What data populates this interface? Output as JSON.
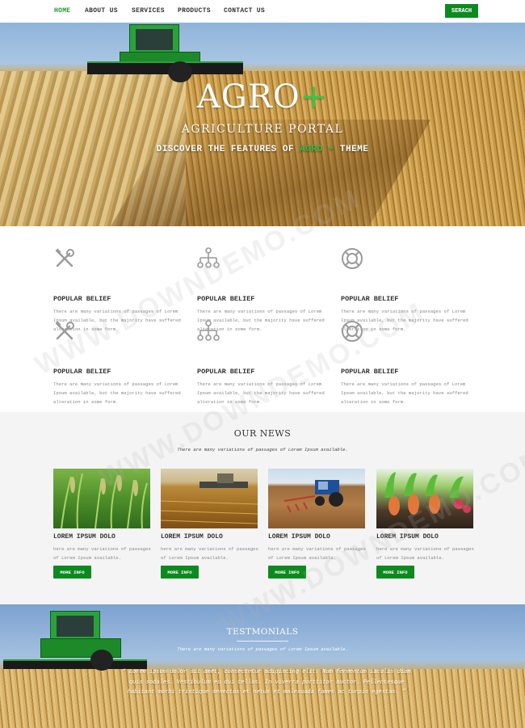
{
  "nav": {
    "items": [
      {
        "label": "HOME",
        "active": true
      },
      {
        "label": "ABOUT US",
        "active": false
      },
      {
        "label": "SERVICES",
        "active": false
      },
      {
        "label": "PRODUCTS",
        "active": false
      },
      {
        "label": "CONTACT US",
        "active": false
      }
    ],
    "search_label": "SERACH"
  },
  "hero": {
    "title_main": "AGRO",
    "title_plus": "+",
    "subtitle": "AGRICULTURE PORTAL",
    "tagline_before": "DISCOVER THE FEATURES OF",
    "tagline_highlight": "AGRO +",
    "tagline_after": "THEME"
  },
  "features": [
    {
      "icon": "tools-icon",
      "title": "POPULAR BELIEF",
      "text": "There are many variations of passages of Lorem Ipsum available, but the majority have suffered alteration in some form."
    },
    {
      "icon": "network-icon",
      "title": "POPULAR BELIEF",
      "text": "There are many variations of passages of Lorem Ipsum available, but the majority have suffered alteration in some form."
    },
    {
      "icon": "lifebuoy-icon",
      "title": "POPULAR BELIEF",
      "text": "There are many variations of passages of Lorem Ipsum available, but the majority have suffered alteration in some form."
    },
    {
      "icon": "tools-icon",
      "title": "POPULAR BELIEF",
      "text": "There are many variations of passages of Lorem Ipsum available, but the majority have suffered alteration in some form."
    },
    {
      "icon": "network-icon",
      "title": "POPULAR BELIEF",
      "text": "There are many variations of passages of Lorem Ipsum available, but the majority have suffered alteration in some form."
    },
    {
      "icon": "lifebuoy-icon",
      "title": "POPULAR BELIEF",
      "text": "There are many variations of passages of Lorem Ipsum available, but the majority have suffered alteration in some form."
    }
  ],
  "news": {
    "title": "OUR NEWS",
    "subtitle": "There are many variations of passages of Lorem Ipsum available.",
    "cards": [
      {
        "title": "LOREM IPSUM DOLO",
        "text": "here are many variations of passages of Lorem Ipsum available.",
        "button": "MORE INFO"
      },
      {
        "title": "LOREM IPSUM DOLO",
        "text": "here are many variations of passages of Lorem Ipsum available.",
        "button": "MORE INFO"
      },
      {
        "title": "LOREM IPSUM DOLO",
        "text": "here are many variations of passages of Lorem Ipsum available.",
        "button": "MORE INFO"
      },
      {
        "title": "LOREM IPSUM DOLO",
        "text": "here are many variations of passages of Lorem Ipsum available.",
        "button": "MORE INFO"
      }
    ]
  },
  "testimonials": {
    "title": "TESTMONIALS",
    "subtitle": "There are many variations of passages of Lorem Ipsum available.",
    "quote": "“ Lorem ipsum dolor sit amet, consectetur adipiscing elit. Nam fermentum iaculis diam quis sodales. Vestibulum eu dui tellus. In viverra porttitor auctor. Pellentesque habitant morbi tristique senectus et netus et malesuada fames ac turpis egestas. ”"
  },
  "watermark": "WWW.DOWNDEMO.COM",
  "colors": {
    "accent": "#0d8a1f",
    "highlight": "#36c648"
  }
}
